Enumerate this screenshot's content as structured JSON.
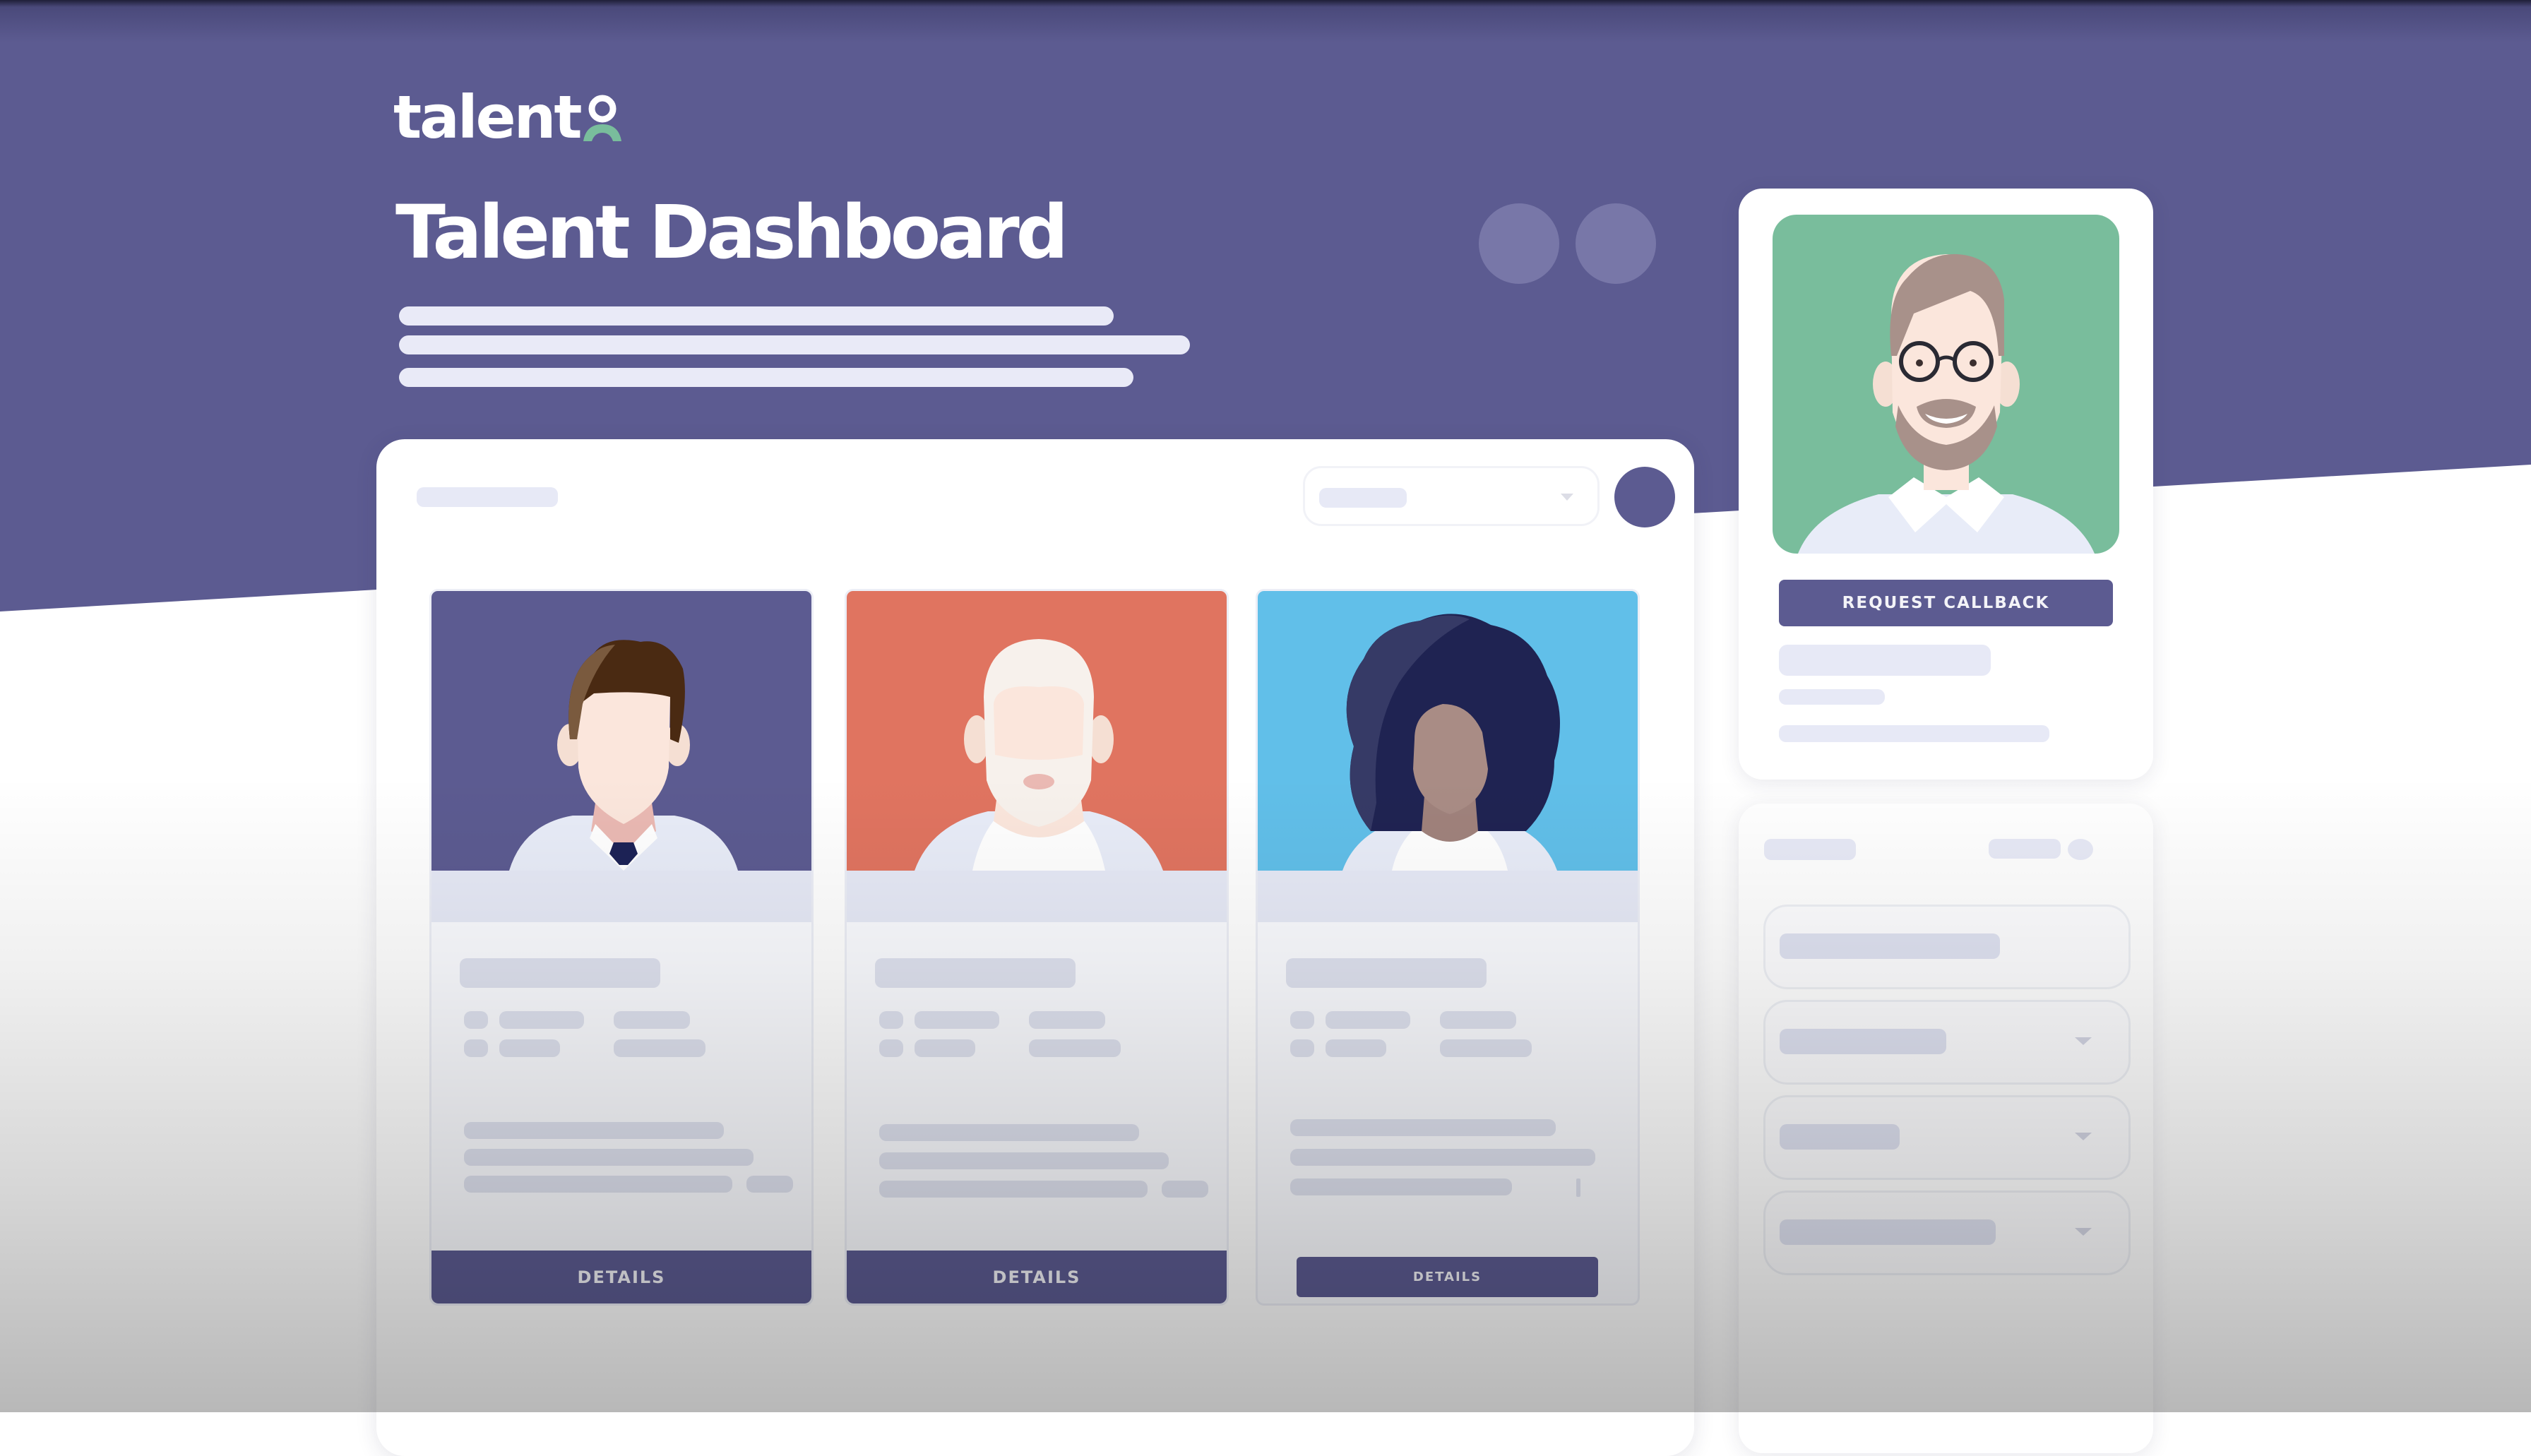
{
  "brand": {
    "name": "talent",
    "logo_icon": "person-icon",
    "colors": {
      "primary": "#5c5b91",
      "accent_green": "#79bd9c",
      "coral": "#e07460",
      "sky": "#61bfe9",
      "skeleton": "#e7e9f6"
    }
  },
  "header": {
    "title": "Talent Dashboard",
    "description_lines": 3,
    "decorative_circles": 2
  },
  "main_panel": {
    "sort_dropdown": {
      "icon": "chevron-down-icon"
    },
    "user_avatar": {
      "icon": "avatar-icon"
    },
    "candidates": [
      {
        "photo_bg": "#5c5b91",
        "avatar": "man-brown-hair-tie",
        "details_label": "DETAILS"
      },
      {
        "photo_bg": "#e07460",
        "avatar": "man-white-beard",
        "details_label": "DETAILS"
      },
      {
        "photo_bg": "#61bfe9",
        "avatar": "woman-curly-hair",
        "details_label": "DETAILS"
      }
    ]
  },
  "profile_card": {
    "photo_bg": "#79bd9c",
    "avatar": "man-glasses-beard",
    "request_callback_label": "REQUEST CALLBACK"
  },
  "filter_panel": {
    "fields": [
      {
        "type": "text",
        "has_dropdown": false
      },
      {
        "type": "select",
        "has_dropdown": true
      },
      {
        "type": "select",
        "has_dropdown": true
      },
      {
        "type": "select",
        "has_dropdown": true
      }
    ]
  }
}
